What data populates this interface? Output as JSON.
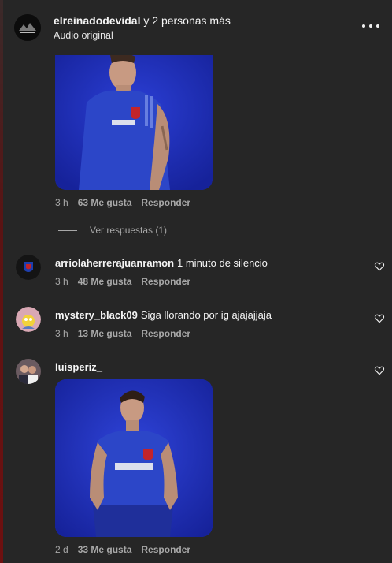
{
  "header": {
    "username": "elreinadodevidal",
    "others": "y 2 personas más",
    "subtitle": "Audio original"
  },
  "top_comment": {
    "time": "3 h",
    "likes": "63 Me gusta",
    "reply": "Responder"
  },
  "view_replies": "Ver respuestas (1)",
  "comments": [
    {
      "username": "arriolaherrerajuanramon",
      "text": "1 minuto de silencio",
      "time": "3 h",
      "likes": "48 Me gusta",
      "reply": "Responder"
    },
    {
      "username": "mystery_black09",
      "text": "Siga llorando por ig ajajajjaja",
      "time": "3 h",
      "likes": "13 Me gusta",
      "reply": "Responder"
    },
    {
      "username": "luisperiz_",
      "text": "",
      "time": "2 d",
      "likes": "33 Me gusta",
      "reply": "Responder"
    }
  ],
  "colors": {
    "background": "#262626",
    "muted": "#a8a8a8",
    "jersey": "#2c46c8",
    "photo_bg": "#1f2fb0"
  },
  "icons": [
    "more-icon",
    "heart-icon"
  ]
}
